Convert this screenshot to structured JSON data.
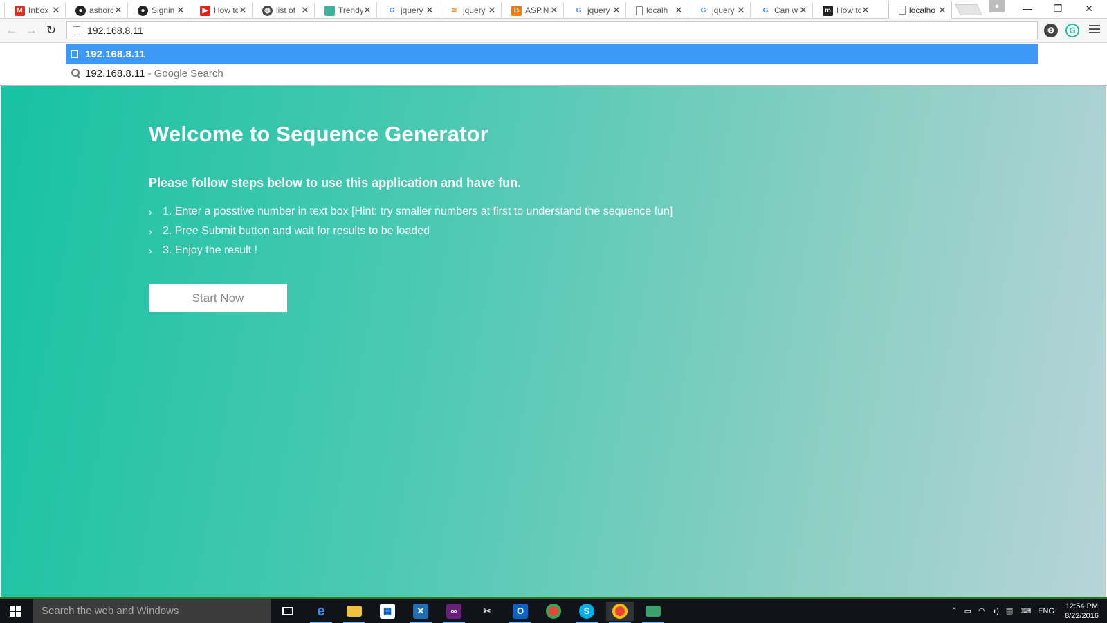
{
  "browser": {
    "tabs": [
      {
        "title": "Inbox (",
        "icon": "gmail-icon",
        "color": "#d93025"
      },
      {
        "title": "ashoro",
        "icon": "github-icon",
        "color": "#222222"
      },
      {
        "title": "Signin",
        "icon": "github-icon",
        "color": "#222222"
      },
      {
        "title": "How to",
        "icon": "youtube-icon",
        "color": "#e62117"
      },
      {
        "title": "list of",
        "icon": "globe-icon",
        "color": "#4a4a4a"
      },
      {
        "title": "Trendy",
        "icon": "site-icon",
        "color": "#3bb3a0"
      },
      {
        "title": "jquery",
        "icon": "google-icon",
        "color": "#4285f4"
      },
      {
        "title": "jquery",
        "icon": "stackoverflow-icon",
        "color": "#f48024"
      },
      {
        "title": "ASP.N",
        "icon": "blogger-icon",
        "color": "#f57d00"
      },
      {
        "title": "jquery",
        "icon": "google-icon",
        "color": "#4285f4"
      },
      {
        "title": "localh",
        "icon": "page-icon",
        "color": "#888888"
      },
      {
        "title": "jquery",
        "icon": "google-icon",
        "color": "#4285f4"
      },
      {
        "title": "Can w",
        "icon": "google-icon",
        "color": "#4285f4"
      },
      {
        "title": "How to",
        "icon": "medium-icon",
        "color": "#222222"
      },
      {
        "title": "localho",
        "icon": "page-icon",
        "color": "#888888"
      }
    ],
    "url": "192.168.8.11",
    "suggestions": {
      "selected": "192.168.8.11",
      "search_query": "192.168.8.11",
      "search_suffix": "- Google Search"
    }
  },
  "page": {
    "title": "Welcome to Sequence Generator",
    "subtitle": "Please follow steps below to use this application and have fun.",
    "steps": [
      "1. Enter a posstive number in text box [Hint: try smaller numbers at first to understand the sequence fun]",
      "2. Pree Submit button and wait for results to be loaded",
      "3. Enjoy the result !"
    ],
    "button_label": "Start Now",
    "gradient": [
      "#17c2a3",
      "#b7d4d8"
    ]
  },
  "taskbar": {
    "search_placeholder": "Search the web and Windows",
    "language": "ENG",
    "time": "12:54 PM",
    "date": "8/22/2016"
  }
}
